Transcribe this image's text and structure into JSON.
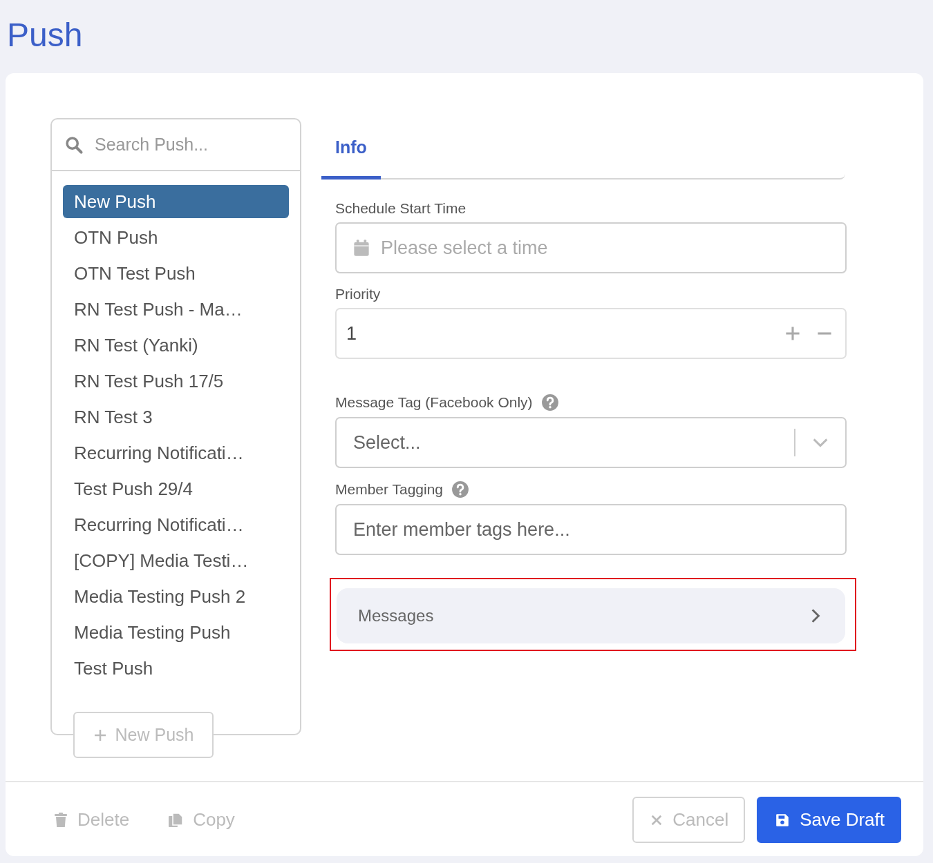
{
  "page": {
    "title": "Push"
  },
  "sidebar": {
    "search": {
      "placeholder": "Search Push..."
    },
    "items": [
      {
        "label": "New Push",
        "selected": true
      },
      {
        "label": "OTN Push",
        "selected": false
      },
      {
        "label": "OTN Test Push",
        "selected": false
      },
      {
        "label": "RN Test Push - Ma…",
        "selected": false
      },
      {
        "label": "RN Test (Yanki)",
        "selected": false
      },
      {
        "label": "RN Test Push 17/5",
        "selected": false
      },
      {
        "label": "RN Test 3",
        "selected": false
      },
      {
        "label": "Recurring Notificati…",
        "selected": false
      },
      {
        "label": "Test Push 29/4",
        "selected": false
      },
      {
        "label": "Recurring Notificati…",
        "selected": false
      },
      {
        "label": "[COPY] Media Testi…",
        "selected": false
      },
      {
        "label": "Media Testing Push 2",
        "selected": false
      },
      {
        "label": "Media Testing Push",
        "selected": false
      },
      {
        "label": "Test Push",
        "selected": false
      }
    ],
    "new_button": {
      "label": "New Push",
      "disabled": true
    }
  },
  "tabs": [
    {
      "label": "Info",
      "selected": true
    }
  ],
  "form": {
    "fields": [
      {
        "kind": "date",
        "label": "Schedule Start Time",
        "placeholder": "Please select a time"
      },
      {
        "kind": "number",
        "label": "Priority",
        "value": "1"
      },
      {
        "kind": "select",
        "label": "Message Tag (Facebook Only)",
        "help": true,
        "placeholder": "Select..."
      },
      {
        "kind": "text",
        "label": "Member Tagging",
        "help": true,
        "placeholder": "Enter member tags here..."
      }
    ],
    "sections": [
      {
        "label": "Messages",
        "highlighted": true
      }
    ]
  },
  "footer": {
    "actions": [
      {
        "kind": "delete",
        "label": "Delete",
        "disabled": true
      },
      {
        "kind": "copy",
        "label": "Copy",
        "disabled": true
      }
    ],
    "buttons": [
      {
        "kind": "cancel",
        "label": "Cancel",
        "disabled": true
      },
      {
        "kind": "save",
        "label": "Save Draft",
        "disabled": false
      }
    ]
  }
}
